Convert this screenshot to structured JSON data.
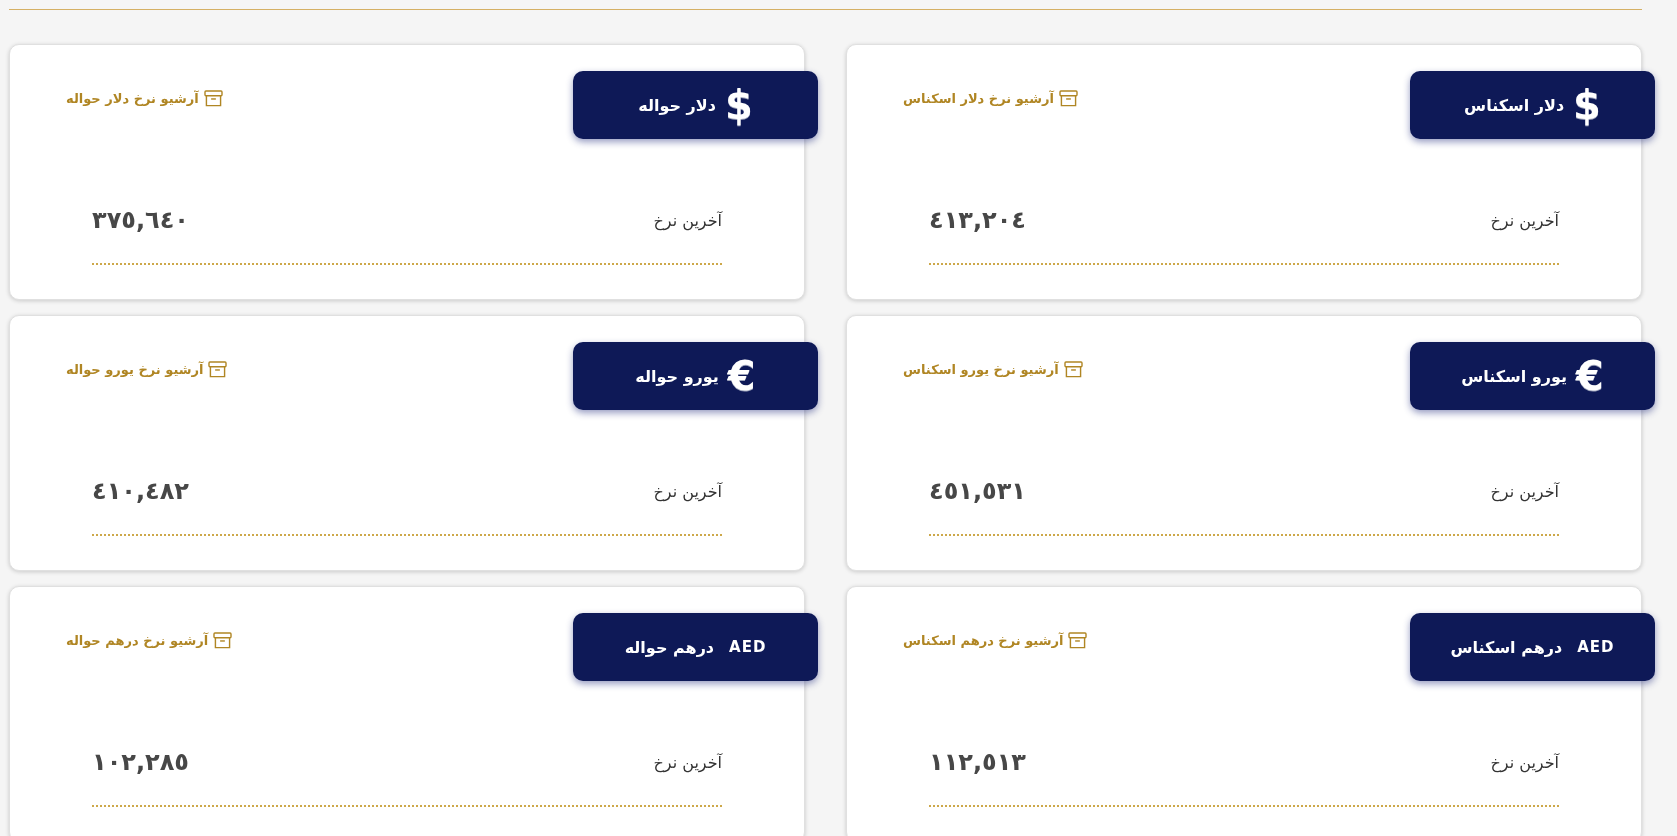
{
  "cards": [
    {
      "kind": "glyph",
      "symbol": "$",
      "title": "دلار اسکناس",
      "archive_link": "آرشیو نرخ دلار اسکناس",
      "rate_label": "آخرین نرخ",
      "rate_value": "٤١٣,٢٠٤"
    },
    {
      "kind": "glyph",
      "symbol": "$",
      "title": "دلار حواله",
      "archive_link": "آرشیو نرخ دلار حواله",
      "rate_label": "آخرین نرخ",
      "rate_value": "٣٧٥,٦٤٠"
    },
    {
      "kind": "glyph",
      "symbol": "€",
      "title": "یورو اسکناس",
      "archive_link": "آرشیو نرخ یورو اسکناس",
      "rate_label": "آخرین نرخ",
      "rate_value": "٤٥١,٥٣١"
    },
    {
      "kind": "glyph",
      "symbol": "€",
      "title": "یورو حواله",
      "archive_link": "آرشیو نرخ یورو حواله",
      "rate_label": "آخرین نرخ",
      "rate_value": "٤١٠,٤٨٢"
    },
    {
      "kind": "code",
      "symbol": "AED",
      "title": "درهم اسکناس",
      "archive_link": "آرشیو نرخ درهم اسکناس",
      "rate_label": "آخرین نرخ",
      "rate_value": "١١٢,٥١٣"
    },
    {
      "kind": "code",
      "symbol": "AED",
      "title": "درهم حواله",
      "archive_link": "آرشیو نرخ درهم حواله",
      "rate_label": "آخرین نرخ",
      "rate_value": "١٠٢,٢٨٥"
    }
  ]
}
